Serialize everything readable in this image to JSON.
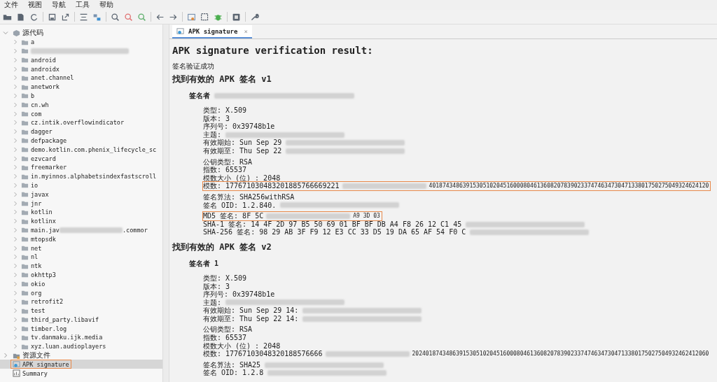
{
  "menu": [
    "文件",
    "视图",
    "导航",
    "工具",
    "帮助"
  ],
  "tree": [
    {
      "kind": "root",
      "label": "源代码",
      "expanded": true,
      "selected": false,
      "children": [
        {
          "label": "a",
          "expanded": false,
          "selected": false
        },
        {
          "redacted": true,
          "expanded": false,
          "selected": false
        },
        {
          "label": "android",
          "expanded": false,
          "selected": false
        },
        {
          "label": "androidx",
          "expanded": false,
          "selected": false
        },
        {
          "label": "anet.channel",
          "expanded": false,
          "selected": false
        },
        {
          "label": "anetwork",
          "expanded": false,
          "selected": false
        },
        {
          "label": "b",
          "expanded": false,
          "selected": false
        },
        {
          "label": "cn.wh",
          "expanded": false,
          "selected": false
        },
        {
          "label": "com",
          "expanded": false,
          "selected": false
        },
        {
          "label": "cz.intik.overflowindicator",
          "expanded": false,
          "selected": false
        },
        {
          "label": "dagger",
          "expanded": false,
          "selected": false
        },
        {
          "label": "defpackage",
          "expanded": false,
          "selected": false
        },
        {
          "label": "demo.kotlin.com.phenix_lifecycle_sc",
          "expanded": false,
          "selected": false
        },
        {
          "label": "ezvcard",
          "expanded": false,
          "selected": false
        },
        {
          "label": "freemarker",
          "expanded": false,
          "selected": false
        },
        {
          "label": "in.myinnos.alphabetsindexfastscroll",
          "expanded": false,
          "selected": false
        },
        {
          "label": "io",
          "expanded": false,
          "selected": false
        },
        {
          "label": "javax",
          "expanded": false,
          "selected": false
        },
        {
          "label": "jnr",
          "expanded": false,
          "selected": false
        },
        {
          "label": "kotlin",
          "expanded": false,
          "selected": false
        },
        {
          "label": "kotlinx",
          "expanded": false,
          "selected": false
        },
        {
          "label": "main.jav",
          "redacted": true,
          "tail": ".commor",
          "expanded": false,
          "selected": false
        },
        {
          "label": "mtopsdk",
          "expanded": false,
          "selected": false
        },
        {
          "label": "net",
          "expanded": false,
          "selected": false
        },
        {
          "label": "nl",
          "expanded": false,
          "selected": false
        },
        {
          "label": "ntk",
          "expanded": false,
          "selected": false
        },
        {
          "label": "okhttp3",
          "expanded": false,
          "selected": false
        },
        {
          "label": "okio",
          "expanded": false,
          "selected": false
        },
        {
          "label": "org",
          "expanded": false,
          "selected": false
        },
        {
          "label": "retrofit2",
          "expanded": false,
          "selected": false
        },
        {
          "label": "test",
          "expanded": false,
          "selected": false
        },
        {
          "label": "third_party.libavif",
          "expanded": false,
          "selected": false
        },
        {
          "label": "timber.log",
          "expanded": false,
          "selected": false
        },
        {
          "label": "tv.danmaku.ijk.media",
          "expanded": false,
          "selected": false
        },
        {
          "label": "xyz.luan.audioplayers",
          "expanded": false,
          "selected": false
        }
      ]
    },
    {
      "kind": "resources",
      "label": "资源文件",
      "expanded": false,
      "selected": false
    },
    {
      "kind": "signature",
      "label": "APK signature",
      "selected": true,
      "highlighted": true
    },
    {
      "kind": "summary",
      "label": "Summary",
      "selected": false
    }
  ],
  "tabs": [
    {
      "label": "APK signature",
      "selected": true,
      "close": "×"
    }
  ],
  "content": {
    "title": "APK signature verification result:",
    "status": "签名验证成功",
    "sections": [
      {
        "heading": "找到有效的 APK 签名 v1",
        "signer": "签名者",
        "signer_redacted": true,
        "groups": [
          [
            {
              "text": "类型: X.509"
            },
            {
              "text": "版本: 3"
            },
            {
              "text": "序列号: 0x39748b1e"
            },
            {
              "text": "主题:",
              "redacted": true
            },
            {
              "text": "有效期始: Sun Sep 29",
              "redacted": true
            },
            {
              "text": "有效期至: Thu Sep 22",
              "redacted": true
            }
          ],
          [
            {
              "text": "公钥类型: RSA"
            },
            {
              "text": "指数: 65537"
            },
            {
              "text": "模数大小 (位) : 2048"
            },
            {
              "text": "模数: 177671030483201885766669221",
              "redacted": true,
              "tail": "40187434863915305102045160008046136082078390233747463473047133801750275049324624120",
              "highlighted": true
            }
          ],
          [
            {
              "text": "签名算法: SHA256withRSA"
            },
            {
              "text": "签名 OID: 1.2.840.",
              "redacted": true
            }
          ],
          [
            {
              "text": "MD5 签名: 8F 5C",
              "redacted": true,
              "tail": "A9 3D 03",
              "highlighted": true
            },
            {
              "text": "SHA-1 签名: 14 4F 2D 97 B5 50 69 01 BF BF DB A4 F8 26 12 C1 45",
              "redacted": true
            },
            {
              "text": "SHA-256 签名: 98 29 AB 3F F9 12 E3 CC 33 D5 19 DA 65 AF 54 F0 C",
              "redacted": true
            }
          ]
        ]
      },
      {
        "heading": "找到有效的 APK 签名 v2",
        "signer": "签名者 1",
        "signer_redacted": false,
        "groups": [
          [
            {
              "text": "类型: X.509"
            },
            {
              "text": "版本: 3"
            },
            {
              "text": "序列号: 0x39748b1e"
            },
            {
              "text": "主题:",
              "redacted": true
            },
            {
              "text": "有效期始: Sun Sep 29 14:",
              "redacted": true
            },
            {
              "text": "有效期至: Thu Sep 22 14:",
              "redacted": true
            }
          ],
          [
            {
              "text": "公钥类型: RSA"
            },
            {
              "text": "指数: 65537"
            },
            {
              "text": "模数大小 (位) : 2048"
            },
            {
              "text": "模数: 17767103048320188576666",
              "redacted": true,
              "tail": "2024018743486391530510204516000804613608207839023374746347304713380175027504932462412060"
            }
          ],
          [
            {
              "text": "签名算法: SHA25",
              "redacted": true
            },
            {
              "text": "签名 OID: 1.2.8",
              "redacted": true
            }
          ]
        ]
      }
    ]
  }
}
